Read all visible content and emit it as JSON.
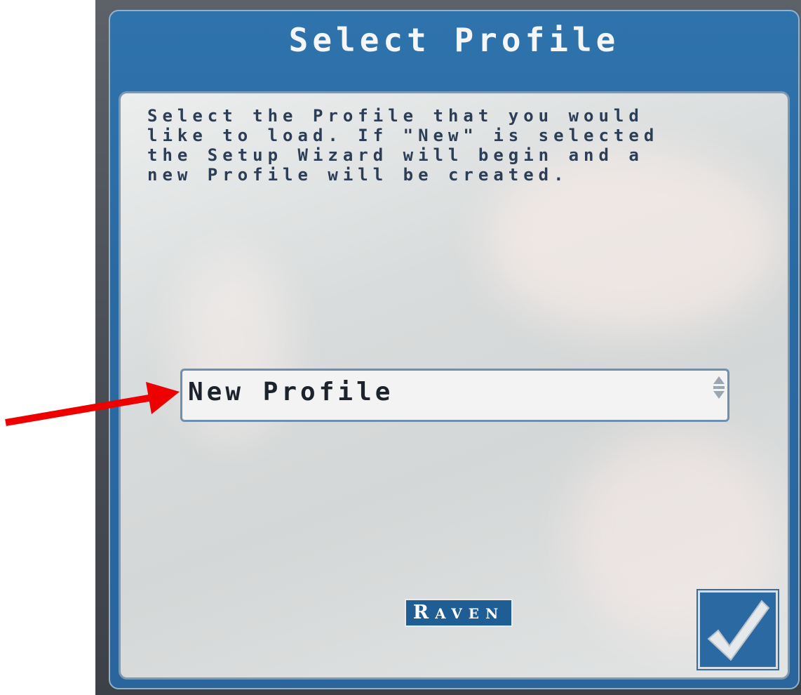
{
  "window": {
    "title": "Select Profile"
  },
  "instructions": {
    "text": "Select the Profile that you would\nlike to load. If \"New\" is selected\nthe Setup Wizard will begin and a\nnew Profile will be created."
  },
  "profile_select": {
    "selected_value": "New Profile"
  },
  "logo": {
    "first_letter": "R",
    "rest": "AVEN"
  },
  "colors": {
    "header_blue": "#2f73ad",
    "panel_gray": "#dcdede",
    "annotation_arrow": "#ee0000"
  },
  "icons": {
    "accept": "checkmark-icon",
    "spinner": "up-down-spinner-icon",
    "annotation": "red-arrow-annotation"
  }
}
